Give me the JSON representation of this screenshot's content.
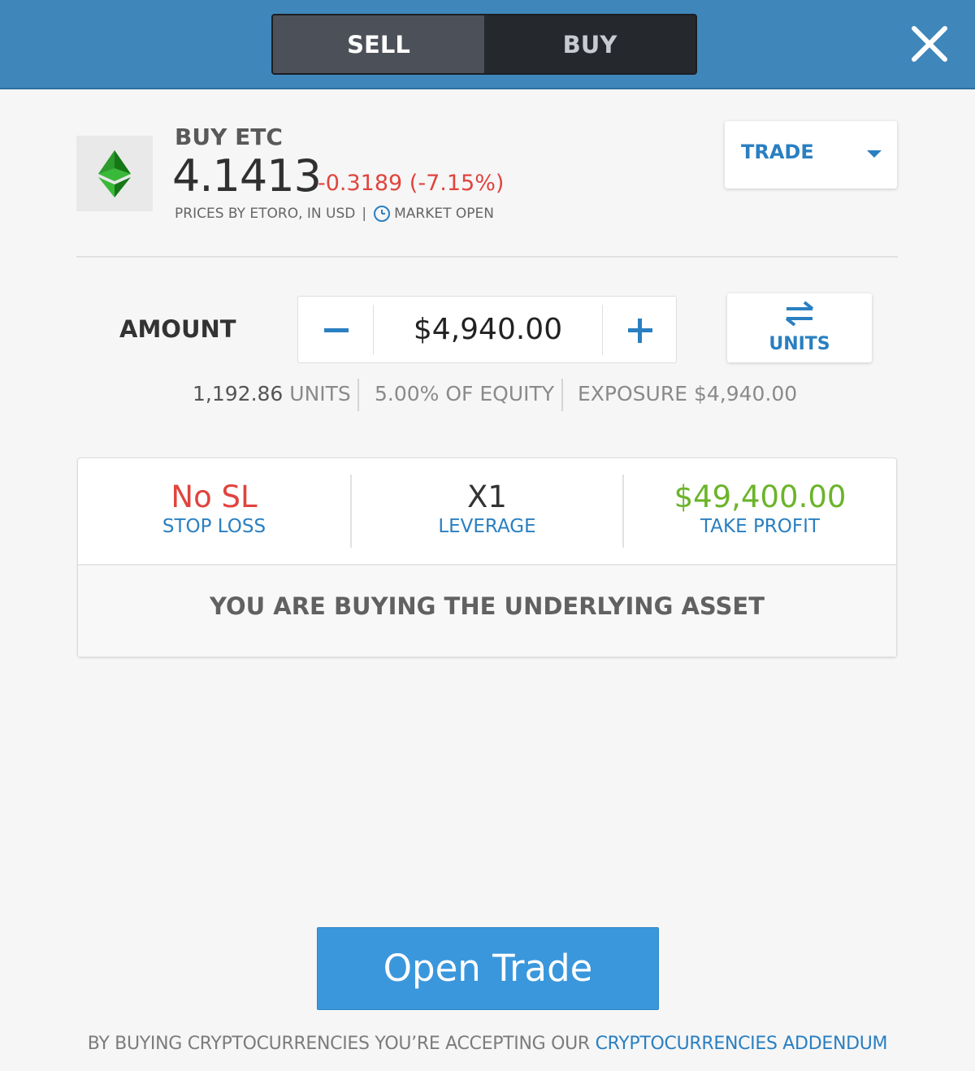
{
  "tabs": {
    "sell": "SELL",
    "buy": "BUY"
  },
  "instrument": {
    "title": "BUY ETC",
    "price": "4.1413",
    "change": "-0.3189 (-7.15%)",
    "source": "PRICES BY ETORO, IN USD",
    "separator": "|",
    "market_status": "MARKET OPEN"
  },
  "trade_mode": {
    "label": "TRADE"
  },
  "amount": {
    "label": "AMOUNT",
    "value": "$4,940.00",
    "toggle_label": "UNITS"
  },
  "summary": {
    "units_value": "1,192.86",
    "units_label": "UNITS",
    "equity": "5.00% OF EQUITY",
    "exposure_label": "EXPOSURE",
    "exposure_value": "$4,940.00"
  },
  "settings": {
    "stop_loss": {
      "value": "No SL",
      "label": "STOP LOSS"
    },
    "leverage": {
      "value": "X1",
      "label": "LEVERAGE"
    },
    "take_profit": {
      "value": "$49,400.00",
      "label": "TAKE PROFIT"
    }
  },
  "note": "YOU ARE BUYING THE UNDERLYING ASSET",
  "open_trade": "Open Trade",
  "footer": {
    "text": "BY BUYING CRYPTOCURRENCIES YOU’RE ACCEPTING OUR",
    "link": "CRYPTOCURRENCIES ADDENDUM"
  },
  "colors": {
    "header": "#3f87bb",
    "accent": "#2a7fc1",
    "negative": "#e0443e",
    "positive": "#6bb42a",
    "button": "#3b97dc"
  },
  "icons": [
    "ethereum-classic-logo-icon",
    "close-icon",
    "clock-icon",
    "chevron-down-icon",
    "minus-icon",
    "plus-icon",
    "swap-arrows-icon"
  ]
}
